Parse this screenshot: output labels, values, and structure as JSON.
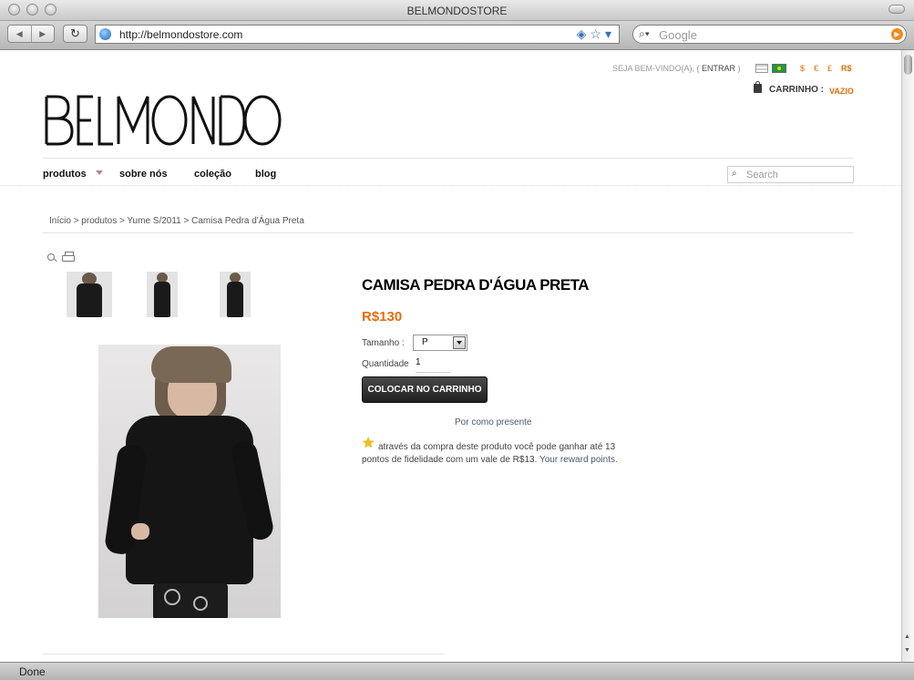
{
  "window": {
    "title": "BELMONDOSTORE"
  },
  "browser": {
    "url": "http://belmondostore.com",
    "search_placeholder": "Google",
    "status": "Done"
  },
  "topbar": {
    "welcome": "SEJA BEM-VINDO(A), (",
    "login": "ENTRAR",
    "close_paren": ")",
    "currencies": [
      "$",
      "€",
      "£",
      "R$"
    ],
    "active_currency": "R$"
  },
  "cart": {
    "label": "CARRINHO :",
    "status": "VAZIO"
  },
  "logo": {
    "text": "BELMONDO"
  },
  "nav": {
    "items": [
      "produtos",
      "sobre nós",
      "coleção",
      "blog"
    ],
    "search_placeholder": "Search"
  },
  "breadcrumb": "Início > produtos > Yume S/2011 > Camisa Pedra d'Água Preta",
  "product": {
    "title": "CAMISA PEDRA D'ÁGUA PRETA",
    "price": "R$130",
    "size_label": "Tamanho :",
    "size_value": "P",
    "qty_label": "Quantidade",
    "qty_value": "1",
    "add_to_cart": "COLOCAR NO CARRINHO",
    "gift": "Por como presente",
    "loyalty_text": "através da compra deste produto você pode ganhar até 13 pontos de fidelidade com um vale de R$13.",
    "loyalty_link": "Your reward points."
  },
  "colors": {
    "accent": "#e46d0a",
    "link": "#475a70",
    "button": "#2b2b2b"
  },
  "icons": [
    "zoom-icon",
    "print-icon",
    "cart-icon",
    "star-icon",
    "search-icon",
    "globe-icon",
    "rss-icon",
    "bookmark-star-icon",
    "reload-icon"
  ]
}
